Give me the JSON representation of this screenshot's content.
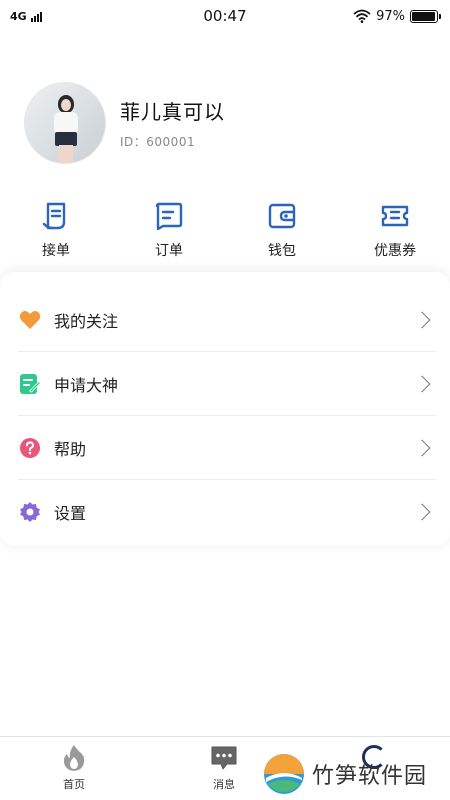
{
  "status_bar": {
    "network": "4G",
    "time": "00:47",
    "battery_percent": "97%",
    "battery_level": 0.97
  },
  "profile": {
    "name": "菲儿真可以",
    "id_text": "ID：600001"
  },
  "actions": [
    {
      "label": "接单",
      "icon": "order-receive-icon"
    },
    {
      "label": "订单",
      "icon": "order-list-icon"
    },
    {
      "label": "钱包",
      "icon": "wallet-icon"
    },
    {
      "label": "优惠券",
      "icon": "coupon-icon"
    }
  ],
  "menu": [
    {
      "label": "我的关注",
      "icon": "heart-icon",
      "color": "#F39A3A"
    },
    {
      "label": "申请大神",
      "icon": "edit-note-icon",
      "color": "#2FC98B"
    },
    {
      "label": "帮助",
      "icon": "help-icon",
      "color": "#E8567A"
    },
    {
      "label": "设置",
      "icon": "settings-gear-icon",
      "color": "#8A67D6"
    }
  ],
  "tab_bar": [
    {
      "label": "首页",
      "icon": "flame-icon"
    },
    {
      "label": "消息",
      "icon": "message-icon"
    }
  ],
  "watermark": {
    "text": "竹笋软件园"
  },
  "colors": {
    "accent": "#2B66B8"
  }
}
